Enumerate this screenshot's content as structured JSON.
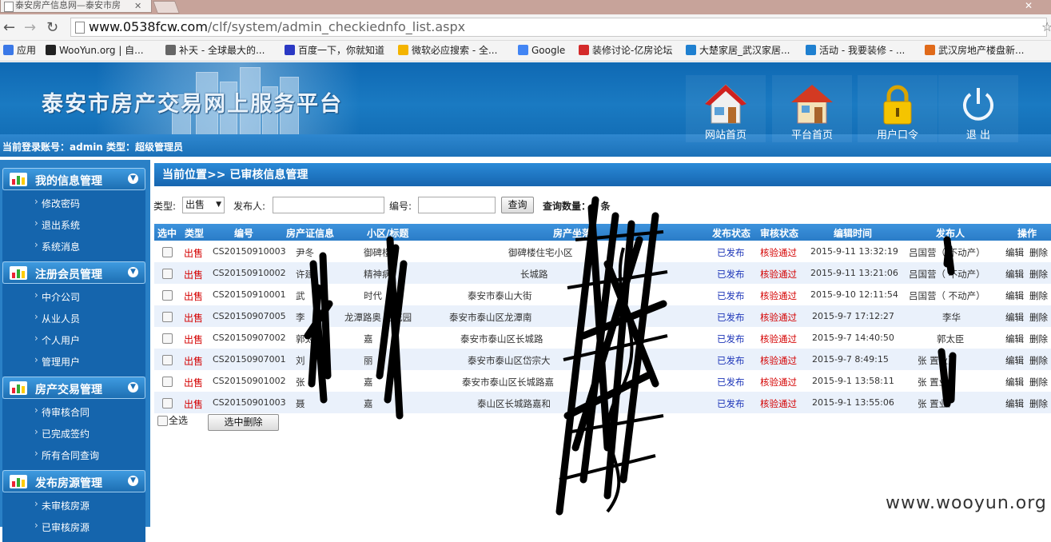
{
  "browser": {
    "tab_title": "泰安房产信息网—泰安市房",
    "url_host": "www.0538fcw.com",
    "url_path": "/clf/system/admin_checkiednfo_list.aspx",
    "bookmarks": [
      {
        "label": "应用",
        "icon": "apps-grid-icon",
        "color": "#3b78e7"
      },
      {
        "label": "WooYun.org | 自...",
        "icon": "wooyun-icon",
        "color": "#222222"
      },
      {
        "label": "补天 - 全球最大的...",
        "icon": "star-icon",
        "color": "#666666"
      },
      {
        "label": "百度一下，你就知道",
        "icon": "baidu-paw-icon",
        "color": "#2b39c4"
      },
      {
        "label": "微软必应搜索 - 全...",
        "icon": "bing-icon",
        "color": "#f4b400"
      },
      {
        "label": "Google",
        "icon": "google-icon",
        "color": "#4285f4"
      },
      {
        "label": "装修讨论-亿房论坛",
        "icon": "fang-icon",
        "color": "#d42a2a"
      },
      {
        "label": "大楚家居_武汉家居...",
        "icon": "ie-icon",
        "color": "#1f80d0"
      },
      {
        "label": "活动 - 我要装修 - ...",
        "icon": "ie-icon",
        "color": "#1f80d0"
      },
      {
        "label": "武汉房地产楼盘新...",
        "icon": "leaf-icon",
        "color": "#e06a1a"
      }
    ]
  },
  "header": {
    "site_title": "泰安市房产交易网上服务平台",
    "login_info": "当前登录账号：admin  类型：超级管理员",
    "buttons": [
      {
        "label": "网站首页",
        "icon": "house-icon"
      },
      {
        "label": "平台首页",
        "icon": "home-icon"
      },
      {
        "label": "用户口令",
        "icon": "lock-icon"
      },
      {
        "label": "退 出",
        "icon": "power-icon"
      }
    ]
  },
  "sidebar": {
    "sections": [
      {
        "title": "我的信息管理",
        "items": [
          "修改密码",
          "退出系统",
          "系统消息"
        ]
      },
      {
        "title": "注册会员管理",
        "items": [
          "中介公司",
          "从业人员",
          "个人用户",
          "管理用户"
        ]
      },
      {
        "title": "房产交易管理",
        "items": [
          "待审核合同",
          "已完成签约",
          "所有合同查询"
        ]
      },
      {
        "title": "发布房源管理",
        "items": [
          "未审核房源",
          "已审核房源"
        ]
      }
    ]
  },
  "main": {
    "breadcrumb": "当前位置>> 已审核信息管理",
    "filter": {
      "type_label": "类型:",
      "type_value": "出售",
      "publisher_label": "发布人:",
      "number_label": "编号:",
      "query_button": "查询",
      "count_text": "查询数量：8 条"
    },
    "columns": [
      "选中",
      "类型",
      "编号",
      "房产证信息",
      "小区/标题",
      "房产坐落",
      "发布状态",
      "审核状态",
      "编辑时间",
      "发布人",
      "操作"
    ],
    "rows": [
      {
        "type": "出售",
        "code": "CS20150910003",
        "cert": "尹冬",
        "title": "御碑楼",
        "location": "御碑楼住宅小区",
        "pub": "已发布",
        "audit": "核验通过",
        "time": "2015-9-11 13:32:19",
        "publisher": "吕国营（     不动产）",
        "edit": "编辑",
        "del": "删除"
      },
      {
        "type": "出售",
        "code": "CS20150910002",
        "cert": "许建",
        "title": "精神病",
        "location": "长城路",
        "pub": "已发布",
        "audit": "核验通过",
        "time": "2015-9-11 13:21:06",
        "publisher": "吕国营（     不动产）",
        "edit": "编辑",
        "del": "删除"
      },
      {
        "type": "出售",
        "code": "CS20150910001",
        "cert": "武",
        "title": "时代",
        "location": "泰安市泰山大街",
        "pub": "已发布",
        "audit": "核验通过",
        "time": "2015-9-10 12:11:54",
        "publisher": "吕国营（     不动产）",
        "edit": "编辑",
        "del": "删除"
      },
      {
        "type": "出售",
        "code": "CS20150907005",
        "cert": "李",
        "title": "龙潭路奥     克花园",
        "location": "泰安市泰山区龙潭南",
        "pub": "已发布",
        "audit": "核验通过",
        "time": "2015-9-7 17:12:27",
        "publisher": "李华",
        "edit": "编辑",
        "del": "删除"
      },
      {
        "type": "出售",
        "code": "CS20150907002",
        "cert": "郭太",
        "title": "嘉",
        "location": "泰安市泰山区长城路",
        "pub": "已发布",
        "audit": "核验通过",
        "time": "2015-9-7 14:40:50",
        "publisher": "郭太臣",
        "edit": "编辑",
        "del": "删除"
      },
      {
        "type": "出售",
        "code": "CS20150907001",
        "cert": "刘",
        "title": "丽",
        "location": "泰安市泰山区岱宗大",
        "pub": "已发布",
        "audit": "核验通过",
        "time": "2015-9-7 8:49:15",
        "publisher": "张     置业）",
        "edit": "编辑",
        "del": "删除"
      },
      {
        "type": "出售",
        "code": "CS20150901002",
        "cert": "张",
        "title": "嘉",
        "location": "泰安市泰山区长城路嘉",
        "pub": "已发布",
        "audit": "核验通过",
        "time": "2015-9-1 13:58:11",
        "publisher": "张     置业）",
        "edit": "编辑",
        "del": "删除"
      },
      {
        "type": "出售",
        "code": "CS20150901003",
        "cert": "聂",
        "title": "嘉",
        "location": "泰山区长城路嘉和",
        "pub": "已发布",
        "audit": "核验通过",
        "time": "2015-9-1 13:55:06",
        "publisher": "张     置业）",
        "edit": "编辑",
        "del": "删除"
      }
    ],
    "select_all_label": "全选",
    "delete_selected_button": "选中删除"
  },
  "watermark": "www.wooyun.org",
  "colors": {
    "header_blue": "#1a7ac2",
    "status_red": "#d40000",
    "status_blue": "#1d35b8",
    "row_alt": "#eaf1fb"
  }
}
